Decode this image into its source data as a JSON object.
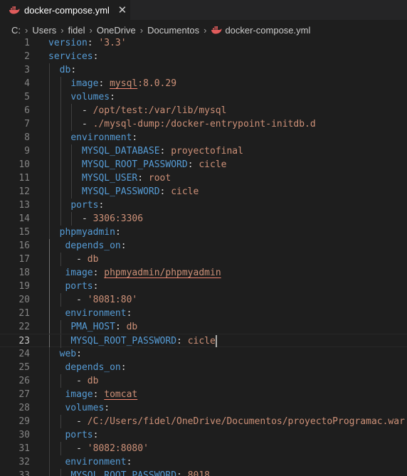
{
  "tab": {
    "title": "docker-compose.yml",
    "close_glyph": "✕",
    "icon": "docker-whale-icon"
  },
  "breadcrumb": {
    "segments": [
      "C:",
      "Users",
      "fidel",
      "OneDrive",
      "Documentos",
      "docker-compose.yml"
    ],
    "separator": "›"
  },
  "editor": {
    "active_line": 23,
    "lines": [
      {
        "n": "1",
        "t": [
          [
            "k",
            "version"
          ],
          [
            "p",
            ": "
          ],
          [
            "v",
            "'3.3'"
          ]
        ]
      },
      {
        "n": "2",
        "t": [
          [
            "k",
            "services"
          ],
          [
            "p",
            ":"
          ]
        ]
      },
      {
        "n": "3",
        "t": [
          [
            "p",
            "  "
          ],
          [
            "k",
            "db"
          ],
          [
            "p",
            ":"
          ]
        ]
      },
      {
        "n": "4",
        "t": [
          [
            "p",
            "    "
          ],
          [
            "k",
            "image"
          ],
          [
            "p",
            ": "
          ],
          [
            "vu",
            "mysql"
          ],
          [
            "v",
            ":8.0.29"
          ]
        ]
      },
      {
        "n": "5",
        "t": [
          [
            "p",
            "    "
          ],
          [
            "k",
            "volumes"
          ],
          [
            "p",
            ":"
          ]
        ]
      },
      {
        "n": "6",
        "t": [
          [
            "p",
            "      - "
          ],
          [
            "v",
            "/opt/test:/var/lib/mysql"
          ]
        ]
      },
      {
        "n": "7",
        "t": [
          [
            "p",
            "      - "
          ],
          [
            "v",
            "./mysql-dump:/docker-entrypoint-initdb.d"
          ]
        ]
      },
      {
        "n": "8",
        "t": [
          [
            "p",
            "    "
          ],
          [
            "k",
            "environment"
          ],
          [
            "p",
            ":"
          ]
        ]
      },
      {
        "n": "9",
        "t": [
          [
            "p",
            "      "
          ],
          [
            "k",
            "MYSQL_DATABASE"
          ],
          [
            "p",
            ": "
          ],
          [
            "v",
            "proyectofinal"
          ]
        ]
      },
      {
        "n": "10",
        "t": [
          [
            "p",
            "      "
          ],
          [
            "k",
            "MYSQL_ROOT_PASSWORD"
          ],
          [
            "p",
            ": "
          ],
          [
            "v",
            "cicle"
          ]
        ]
      },
      {
        "n": "11",
        "t": [
          [
            "p",
            "      "
          ],
          [
            "k",
            "MYSQL_USER"
          ],
          [
            "p",
            ": "
          ],
          [
            "v",
            "root"
          ]
        ]
      },
      {
        "n": "12",
        "t": [
          [
            "p",
            "      "
          ],
          [
            "k",
            "MYSQL_PASSWORD"
          ],
          [
            "p",
            ": "
          ],
          [
            "v",
            "cicle"
          ]
        ]
      },
      {
        "n": "13",
        "t": [
          [
            "p",
            "    "
          ],
          [
            "k",
            "ports"
          ],
          [
            "p",
            ":"
          ]
        ]
      },
      {
        "n": "14",
        "t": [
          [
            "p",
            "      - "
          ],
          [
            "v",
            "3306:3306"
          ]
        ]
      },
      {
        "n": "15",
        "t": [
          [
            "p",
            "  "
          ],
          [
            "k",
            "phpmyadmin"
          ],
          [
            "p",
            ":"
          ]
        ]
      },
      {
        "n": "16",
        "t": [
          [
            "p",
            "   "
          ],
          [
            "k",
            "depends_on"
          ],
          [
            "p",
            ":"
          ]
        ]
      },
      {
        "n": "17",
        "t": [
          [
            "p",
            "     - "
          ],
          [
            "v",
            "db"
          ]
        ]
      },
      {
        "n": "18",
        "t": [
          [
            "p",
            "   "
          ],
          [
            "k",
            "image"
          ],
          [
            "p",
            ": "
          ],
          [
            "vu",
            "phpmyadmin/phpmyadmin"
          ]
        ]
      },
      {
        "n": "19",
        "t": [
          [
            "p",
            "   "
          ],
          [
            "k",
            "ports"
          ],
          [
            "p",
            ":"
          ]
        ]
      },
      {
        "n": "20",
        "t": [
          [
            "p",
            "     - "
          ],
          [
            "v",
            "'8081:80'"
          ]
        ]
      },
      {
        "n": "21",
        "t": [
          [
            "p",
            "   "
          ],
          [
            "k",
            "environment"
          ],
          [
            "p",
            ":"
          ]
        ]
      },
      {
        "n": "22",
        "t": [
          [
            "p",
            "    "
          ],
          [
            "k",
            "PMA_HOST"
          ],
          [
            "p",
            ": "
          ],
          [
            "v",
            "db"
          ]
        ]
      },
      {
        "n": "23",
        "t": [
          [
            "p",
            "    "
          ],
          [
            "k",
            "MYSQL_ROOT_PASSWORD"
          ],
          [
            "p",
            ": "
          ],
          [
            "v",
            "cicle"
          ]
        ]
      },
      {
        "n": "24",
        "t": [
          [
            "p",
            "  "
          ],
          [
            "k",
            "web"
          ],
          [
            "p",
            ":"
          ]
        ]
      },
      {
        "n": "25",
        "t": [
          [
            "p",
            "   "
          ],
          [
            "k",
            "depends_on"
          ],
          [
            "p",
            ":"
          ]
        ]
      },
      {
        "n": "26",
        "t": [
          [
            "p",
            "     - "
          ],
          [
            "v",
            "db"
          ]
        ]
      },
      {
        "n": "27",
        "t": [
          [
            "p",
            "   "
          ],
          [
            "k",
            "image"
          ],
          [
            "p",
            ": "
          ],
          [
            "vu",
            "tomcat"
          ]
        ]
      },
      {
        "n": "28",
        "t": [
          [
            "p",
            "   "
          ],
          [
            "k",
            "volumes"
          ],
          [
            "p",
            ":"
          ]
        ]
      },
      {
        "n": "29",
        "t": [
          [
            "p",
            "     - "
          ],
          [
            "v",
            "/C:/Users/fidel/OneDrive/Documentos/proyectoProgramac.war:"
          ]
        ]
      },
      {
        "n": "30",
        "t": [
          [
            "p",
            "   "
          ],
          [
            "k",
            "ports"
          ],
          [
            "p",
            ":"
          ]
        ]
      },
      {
        "n": "31",
        "t": [
          [
            "p",
            "     - "
          ],
          [
            "v",
            "'8082:8080'"
          ]
        ]
      },
      {
        "n": "32",
        "t": [
          [
            "p",
            "   "
          ],
          [
            "k",
            "environment"
          ],
          [
            "p",
            ":"
          ]
        ]
      },
      {
        "n": "33",
        "t": [
          [
            "p",
            "    "
          ],
          [
            "k",
            "MYSQL_ROOT_PASSWORD"
          ],
          [
            "p",
            ": "
          ],
          [
            "v",
            "8018"
          ]
        ]
      }
    ]
  },
  "colors": {
    "background": "#1e1e1e",
    "key": "#569cd6",
    "string": "#ce9178",
    "line_number": "#858585",
    "docker_icon": "#e05c5c"
  }
}
